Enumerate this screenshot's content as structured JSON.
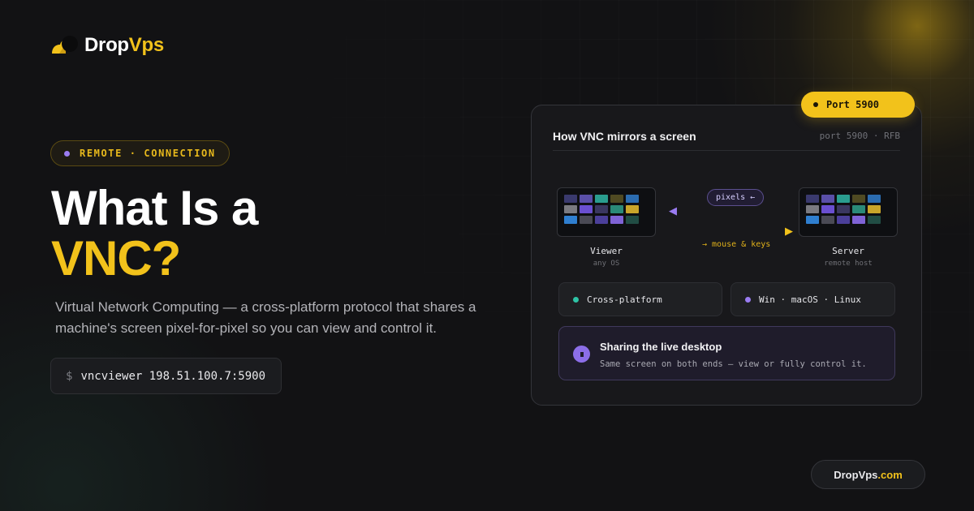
{
  "brand": {
    "name_main": "Drop",
    "name_accent": "Vps"
  },
  "pill": {
    "label": "REMOTE · CONNECTION"
  },
  "headline": {
    "line1": "What Is a",
    "line2": "VNC?"
  },
  "subtitle": "Virtual Network Computing — a cross-platform protocol that shares a machine's screen pixel-for-pixel so you can view and control it.",
  "command": {
    "prompt": "$",
    "text": "vncviewer 198.51.100.7:5900"
  },
  "badge": {
    "label": "Port 5900"
  },
  "card": {
    "title": "How VNC mirrors a screen",
    "meta": "port 5900 · RFB",
    "viewer": {
      "name": "Viewer",
      "sub": "any OS"
    },
    "server": {
      "name": "Server",
      "sub": "remote host"
    },
    "pixels_label": "pixels ←",
    "keys_label": "→ mouse & keys",
    "arrow_left": "◀",
    "arrow_right": "▶",
    "features": [
      {
        "label": "Cross-platform",
        "color": "#2ec4a6"
      },
      {
        "label": "Win · macOS · Linux",
        "color": "#9a7cf2"
      }
    ],
    "share": {
      "title": "Sharing the live desktop",
      "subtitle": "Same screen on both ends — view or fully control it."
    }
  },
  "screen_tiles": [
    "#3a3a6e",
    "#5a4fa8",
    "#2a9d8f",
    "#4f4a22",
    "#2b6cb0",
    "#7a7a80",
    "#6a4fd0",
    "#3a3760",
    "#2a8a78",
    "#c9a52a",
    "#2f7fd0",
    "#4a4a55",
    "#4b3f9a",
    "#7f63d6",
    "#214d44"
  ],
  "footer": {
    "site_main": "DropVps",
    "site_accent": ".com"
  },
  "colors": {
    "accent": "#f2c21b",
    "purple": "#9a7cf2",
    "teal": "#2ec4a6",
    "background": "#121214"
  }
}
